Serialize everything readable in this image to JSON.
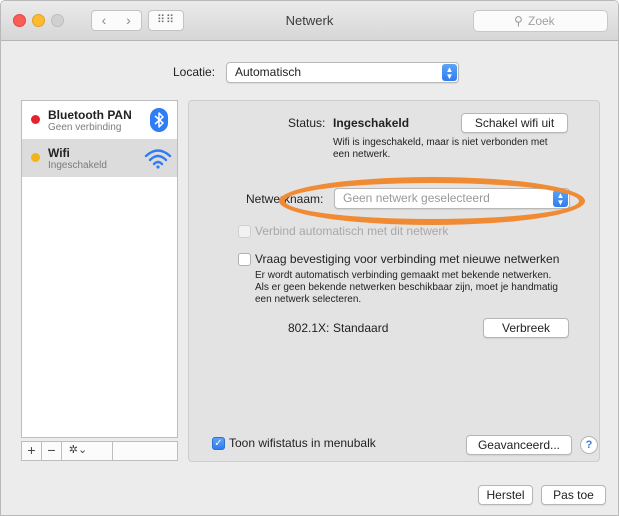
{
  "window": {
    "title": "Netwerk",
    "search_placeholder": "Zoek",
    "nav_back": "‹",
    "nav_forward": "›",
    "grid_icon": "⠿⠿"
  },
  "location": {
    "label": "Locatie:",
    "value": "Automatisch"
  },
  "sidebar": {
    "items": [
      {
        "name": "Bluetooth PAN",
        "status": "Geen verbinding",
        "dot_color": "#e8222c",
        "icon": "bluetooth-icon"
      },
      {
        "name": "Wifi",
        "status": "Ingeschakeld",
        "dot_color": "#f3b319",
        "icon": "wifi-icon"
      }
    ],
    "tools": {
      "add": "+",
      "remove": "−",
      "gear": "✲⌄"
    }
  },
  "main": {
    "status_label": "Status:",
    "status_value": "Ingeschakeld",
    "wifi_off_button": "Schakel wifi uit",
    "status_desc": "Wifi is ingeschakeld, maar is niet verbonden met een netwerk.",
    "network_name_label": "Netwerknaam:",
    "network_name_placeholder": "Geen netwerk geselecteerd",
    "auto_join_label": "Verbind automatisch met dit netwerk",
    "ask_join_label": "Vraag bevestiging voor verbinding met nieuwe netwerken",
    "ask_join_desc": "Er wordt automatisch verbinding gemaakt met bekende netwerken. Als er geen bekende netwerken beschikbaar zijn, moet je handmatig een netwerk selecteren.",
    "dot1x_label": "802.1X:",
    "dot1x_value": "Standaard",
    "disconnect_button": "Verbreek",
    "show_status_label": "Toon wifistatus in menubalk",
    "advanced_button": "Geavanceerd...",
    "help": "?"
  },
  "footer": {
    "revert_button": "Herstel",
    "apply_button": "Pas toe"
  },
  "colors": {
    "highlight_ring": "#f08a33",
    "accent_blue": "#2f7cf0"
  }
}
